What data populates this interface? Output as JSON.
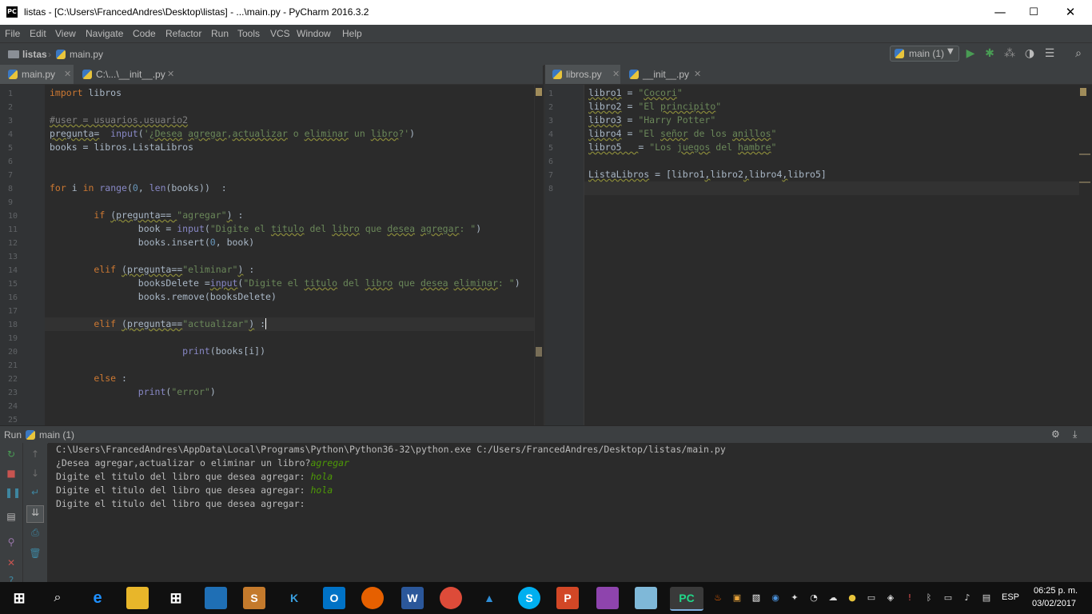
{
  "window": {
    "title": "listas - [C:\\Users\\FrancedAndres\\Desktop\\listas] - ...\\main.py - PyCharm 2016.3.2",
    "app_icon": "PC",
    "minimize": "—",
    "maximize": "☐",
    "close": "✕"
  },
  "menu": [
    "File",
    "Edit",
    "View",
    "Navigate",
    "Code",
    "Refactor",
    "Run",
    "Tools",
    "VCS",
    "Window",
    "Help"
  ],
  "breadcrumb": {
    "project": "listas",
    "file": "main.py"
  },
  "run_config": "main (1)",
  "left_tabs": [
    {
      "label": "main.py"
    },
    {
      "label": "C:\\...\\__init__.py"
    }
  ],
  "right_tabs": [
    {
      "label": "libros.py"
    },
    {
      "label": "__init__.py"
    }
  ],
  "left_editor": {
    "line_numbers": [
      "1",
      "2",
      "3",
      "4",
      "5",
      "6",
      "7",
      "8",
      "9",
      "10",
      "11",
      "12",
      "13",
      "14",
      "15",
      "16",
      "17",
      "18",
      "19",
      "20",
      "21",
      "22",
      "23",
      "24",
      "25"
    ]
  },
  "right_editor": {
    "line_numbers": [
      "1",
      "2",
      "3",
      "4",
      "5",
      "6",
      "7",
      "8"
    ]
  },
  "run_panel": {
    "label": "Run",
    "config": "main (1)",
    "lines": [
      {
        "text": "C:\\Users\\FrancedAndres\\AppData\\Local\\Programs\\Python\\Python36-32\\python.exe C:/Users/FrancedAndres/Desktop/listas/main.py",
        "input": ""
      },
      {
        "text": "¿Desea agregar,actualizar o eliminar un libro?",
        "input": "agregar"
      },
      {
        "text": "Digite el titulo del libro que desea agregar: ",
        "input": "hola"
      },
      {
        "text": "Digite el titulo del libro que desea agregar: ",
        "input": "hola"
      },
      {
        "text": "Digite el titulo del libro que desea agregar: ",
        "input": ""
      }
    ]
  },
  "taskbar": {
    "lang": "ESP",
    "time": "06:25 p. m.",
    "date": "03/02/2017"
  },
  "colors": {
    "bg": "#2b2b2b",
    "panel": "#3c3f41",
    "keyword": "#cc7832",
    "string": "#6a8759",
    "number": "#6897bb",
    "builtin": "#8888c6",
    "run_green": "#499c54"
  }
}
